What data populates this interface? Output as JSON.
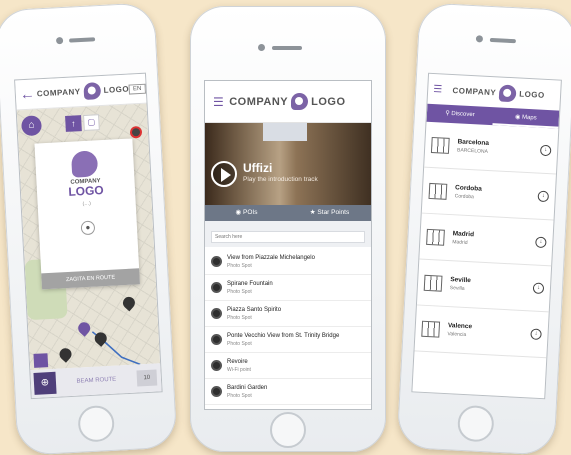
{
  "brand": {
    "word1": "COMPANY",
    "word2": "LOGO",
    "accent": "#6f54a3"
  },
  "map_screen": {
    "lang_label": "EN",
    "card_company": "COMPANY",
    "card_logo": "LOGO",
    "card_subtitle": "(…)",
    "card_button": "ZAGITA EN ROUTE",
    "bottom_label": "BEAM ROUTE",
    "bottom_right": "10"
  },
  "tour_screen": {
    "title": "Uffizi",
    "subtitle": "Play the introduction track",
    "tabs": [
      {
        "label": "POIs",
        "icon": "pin-icon"
      },
      {
        "label": "Star Points",
        "icon": "star-icon"
      }
    ],
    "search_placeholder": "Search here",
    "pois": [
      {
        "name": "View from Piazzale Michelangelo",
        "type": "Photo Spot"
      },
      {
        "name": "Spirane Fountain",
        "type": "Photo Spot"
      },
      {
        "name": "Piazza Santo Spirito",
        "type": "Photo Spot"
      },
      {
        "name": "Ponte Vecchio View from St. Trinity Bridge",
        "type": "Photo Spot"
      },
      {
        "name": "Revoire",
        "type": "Wi-Fi point"
      },
      {
        "name": "Bardini Garden",
        "type": "Photo Spot"
      }
    ]
  },
  "cities_screen": {
    "tabs": [
      {
        "label": "Discover",
        "icon": "search-icon"
      },
      {
        "label": "Maps",
        "icon": "pin-icon"
      }
    ],
    "cities": [
      {
        "name": "Barcelona",
        "sub": "BARCELONA"
      },
      {
        "name": "Cordoba",
        "sub": "Cordoba"
      },
      {
        "name": "Madrid",
        "sub": "Madrid"
      },
      {
        "name": "Seville",
        "sub": "Sevilla"
      },
      {
        "name": "Valence",
        "sub": "Valencia"
      }
    ]
  }
}
